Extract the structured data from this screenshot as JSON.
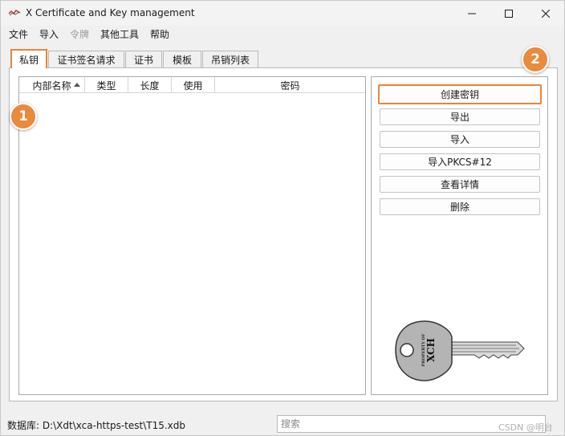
{
  "window": {
    "title": "X Certificate and Key management"
  },
  "menu": [
    {
      "label": "文件",
      "enabled": true
    },
    {
      "label": "导入",
      "enabled": true
    },
    {
      "label": "令牌",
      "enabled": false
    },
    {
      "label": "其他工具",
      "enabled": true
    },
    {
      "label": "帮助",
      "enabled": true
    }
  ],
  "tabs": [
    {
      "label": "私钥",
      "active": true
    },
    {
      "label": "证书签名请求",
      "active": false
    },
    {
      "label": "证书",
      "active": false
    },
    {
      "label": "模板",
      "active": false
    },
    {
      "label": "吊销列表",
      "active": false
    }
  ],
  "list": {
    "columns": [
      "内部名称",
      "类型",
      "长度",
      "使用",
      "密码"
    ],
    "sorted_column": "内部名称",
    "sort_direction": "ascending",
    "rows": []
  },
  "actions": [
    "创建密钥",
    "导出",
    "导入",
    "导入PKCS#12",
    "查看详情",
    "删除"
  ],
  "badges": [
    "1",
    "2"
  ],
  "key_illustration": {
    "text_small": "PROPERTY OF",
    "text_large": "XCH"
  },
  "status": {
    "database_text": "数据库: D:\\Xdt\\xca-https-test\\T15.xdb"
  },
  "search": {
    "placeholder": "搜索",
    "value": ""
  },
  "watermark": "CSDN @明台",
  "colors": {
    "accent": "#e8853a",
    "badge": "#ea8a3c",
    "window_bg": "#f0f0f0",
    "panel_bg": "#ffffff"
  }
}
